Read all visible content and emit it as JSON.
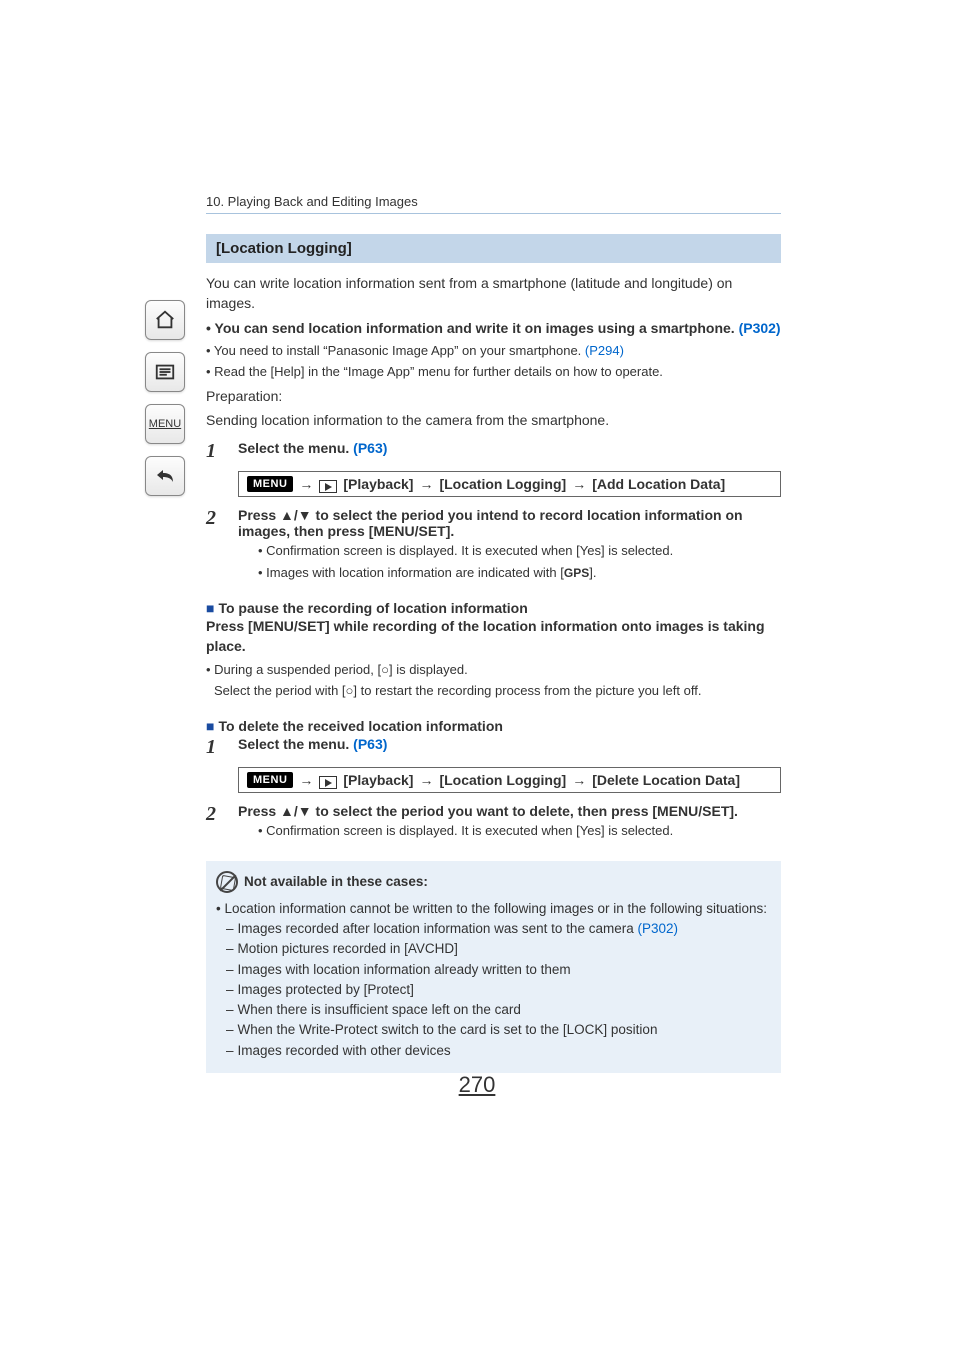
{
  "sidebar": {
    "menu_label": "MENU"
  },
  "breadcrumb": "10. Playing Back and Editing Images",
  "heading": "[Location Logging]",
  "intro": {
    "p1": "You can write location information sent from a smartphone (latitude and longitude) on images.",
    "bullet_bold_prefix": "• You can send location information and write it on images using a smartphone. ",
    "bullet_bold_link": "(P302)",
    "b2_text": "• You need to install “Panasonic Image App” on your smartphone. ",
    "b2_link": "(P294)",
    "b3": "• Read the [Help] in the “Image App” menu for further details on how to operate.",
    "prep_label": "Preparation:",
    "prep_text": "Sending location information to the camera from the smartphone."
  },
  "step1": {
    "num": "1",
    "text": "Select the menu. ",
    "link": "(P63)"
  },
  "menu_path1": {
    "menu_label": "MENU",
    "part1": "[Playback]",
    "part2": "[Location Logging]",
    "part3": "[Add Location Data]"
  },
  "step2": {
    "num": "2",
    "line1": "Press ▲/▼ to select the period you intend to record location information on images, then press [MENU/SET].",
    "sub1": "• Confirmation screen is displayed. It is executed when [Yes] is selected.",
    "sub2_pre": "• Images with location information are indicated with [",
    "sub2_gps": "GPS",
    "sub2_post": "]."
  },
  "pause": {
    "heading": "To pause the recording of location information",
    "bold": "Press [MENU/SET] while recording of the location information onto images is taking place.",
    "b1_pre": "• During a suspended period, [",
    "b1_mid": "¢",
    "b1_post": "] is displayed.",
    "b2_pre": "Select the period with [",
    "b2_post": "] to restart the recording process from the picture you left off."
  },
  "delete": {
    "heading": "To delete the received location information",
    "step1_num": "1",
    "step1_text": "Select the menu. ",
    "step1_link": "(P63)",
    "path": {
      "menu_label": "MENU",
      "part1": "[Playback]",
      "part2": "[Location Logging]",
      "part3": "[Delete Location Data]"
    },
    "step2_num": "2",
    "step2_line": "Press ▲/▼ to select the period you want to delete, then press [MENU/SET].",
    "step2_sub": "• Confirmation screen is displayed. It is executed when [Yes] is selected."
  },
  "notice": {
    "heading": "Not available in these cases:",
    "lead": "• Location information cannot be written to the following images or in the following situations:",
    "d1_pre": "Images recorded after location information was sent to the camera ",
    "d1_link": "(P302)",
    "d2": "Motion pictures recorded in [AVCHD]",
    "d3": "Images with location information already written to them",
    "d4": "Images protected by [Protect]",
    "d5": "When there is insufficient space left on the card",
    "d6": "When the Write-Protect switch to the card is set to the [LOCK] position",
    "d7": "Images recorded with other devices"
  },
  "page_number": "270"
}
